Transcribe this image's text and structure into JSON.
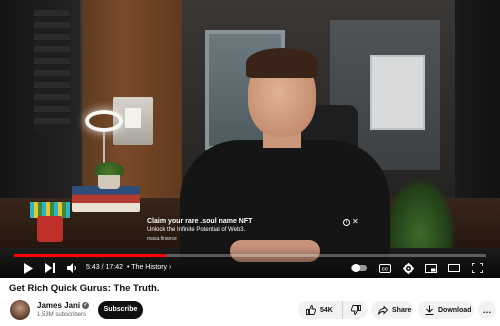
{
  "video": {
    "ad": {
      "title": "Claim your rare .soul name NFT",
      "subtitle": "Unlock the Infinite Potential of Web3.",
      "domain": "masa.finance"
    },
    "time_display": "5:43 / 17:42",
    "chapter": "• The History",
    "progress": 0.323,
    "controls": {
      "play_icon": "play-icon",
      "next_icon": "next-icon",
      "volume_icon": "volume-icon",
      "autoplay_icon": "autoplay-toggle-icon",
      "captions_icon": "captions-icon",
      "settings_icon": "gear-icon",
      "miniplayer_icon": "miniplayer-icon",
      "theater_icon": "theater-mode-icon",
      "fullscreen_icon": "fullscreen-icon"
    },
    "accent_color": "#ff0000"
  },
  "title": "Get Rich Quick Gurus: The Truth.",
  "channel": {
    "name": "James Jani",
    "subscribers": "1.53M subscribers",
    "subscribe_label": "Subscribe"
  },
  "actions": {
    "likes": "54K",
    "share_label": "Share",
    "download_label": "Download",
    "more_label": "…"
  }
}
